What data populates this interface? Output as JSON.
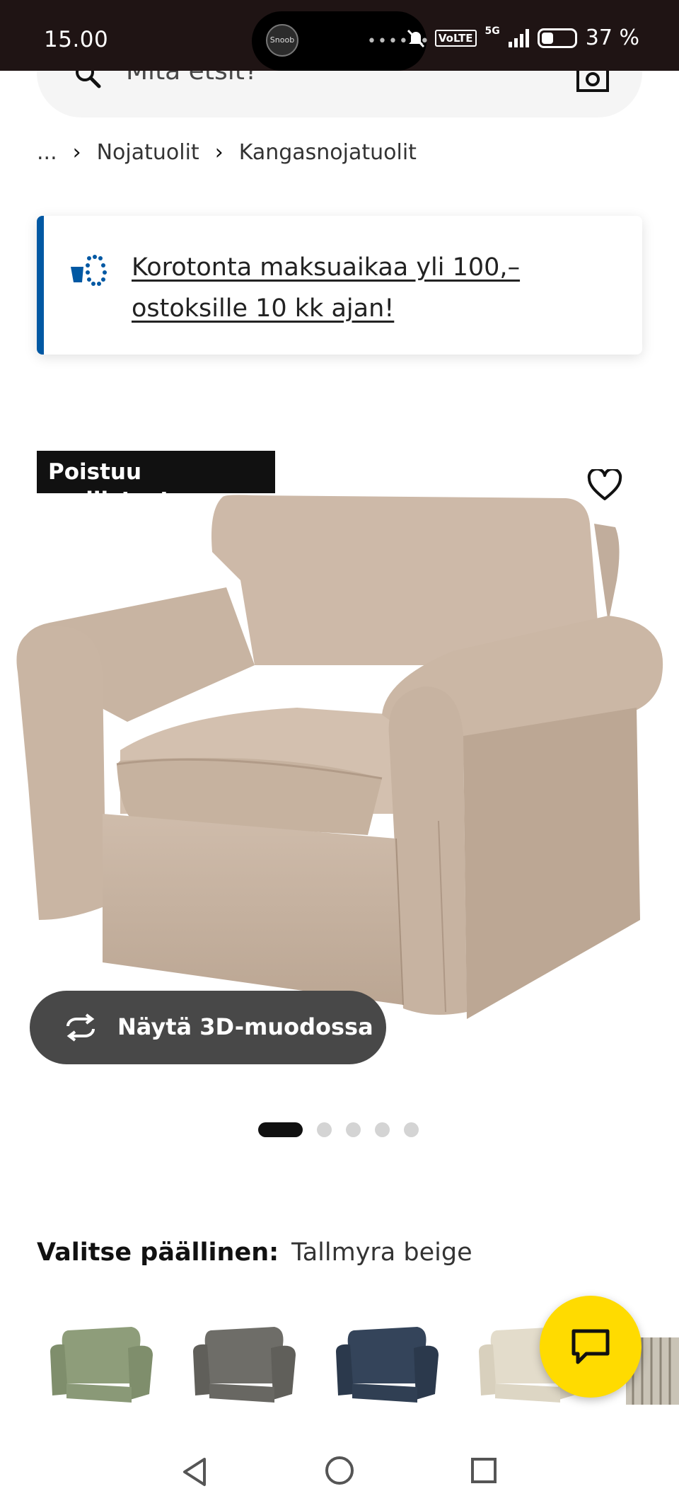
{
  "status_bar": {
    "time": "15.00",
    "logo_text": "Snoob",
    "dots": "••••••",
    "volte": "VoLTE",
    "network": "5G",
    "battery": "37 %"
  },
  "search": {
    "placeholder": "Mitä etsit?"
  },
  "breadcrumb": {
    "ellipsis": "...",
    "items": [
      "Nojatuolit",
      "Kangasnojatuolit"
    ]
  },
  "promo": {
    "text": "Korotonta maksuaikaa yli 100,– ostoksille 10 kk ajan!",
    "accent_color": "#0058a3"
  },
  "product": {
    "badge": "Poistuu mallistosta",
    "view_3d_label": "Näytä 3D-muodossa",
    "image_count": 5,
    "active_image_index": 0,
    "cover_label": "Valitse päällinen:",
    "cover_value": "Tallmyra beige",
    "swatch_colors": [
      "#8e9d7a",
      "#6e6d68",
      "#34445a",
      "#e3dccb",
      "#c9c3b6"
    ]
  },
  "chat": {
    "icon": "chat-icon",
    "color": "#ffdb00"
  },
  "nav": {
    "back": "back-icon",
    "home": "home-icon",
    "recent": "recent-apps-icon"
  }
}
